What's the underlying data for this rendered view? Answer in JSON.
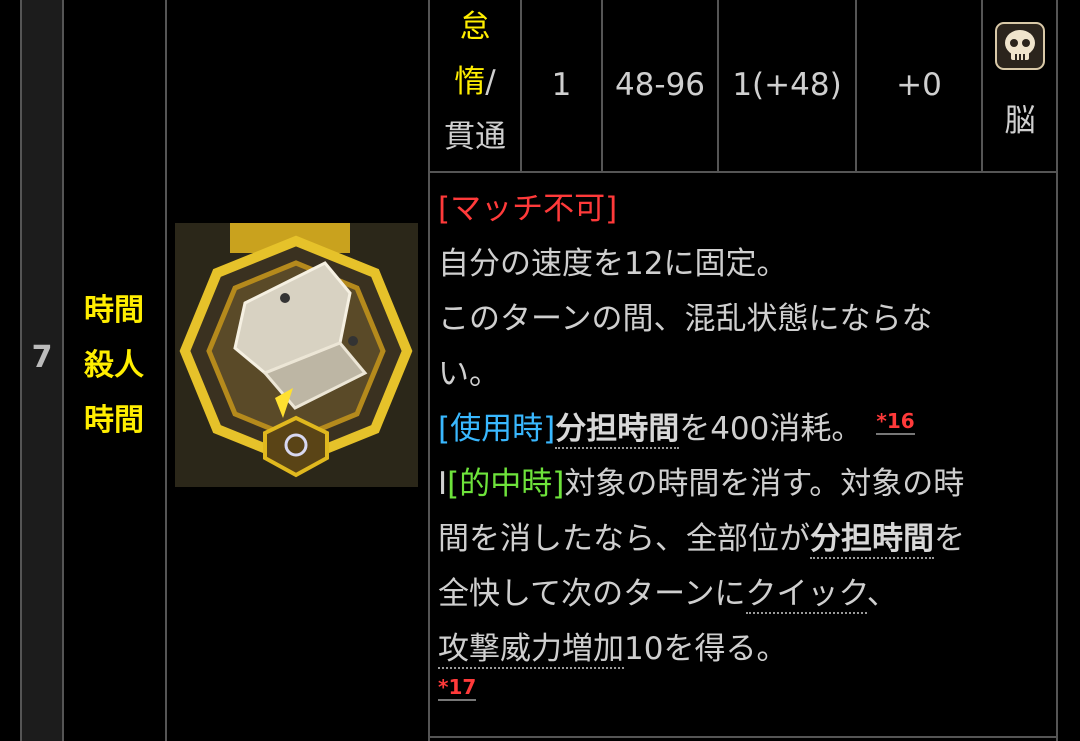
{
  "row": {
    "number": "7",
    "name_lines": [
      "時間",
      "殺人",
      "時間"
    ]
  },
  "stats": {
    "type_line1": "怠",
    "type_line2_yellow": "惰",
    "type_line2_rest": "/",
    "type_line3": "貫通",
    "col1": "1",
    "col2": "48-96",
    "col3": "1(+48)",
    "col4": "+0",
    "target_label": "脳",
    "target_icon": "skull-icon"
  },
  "description": {
    "line1": "[マッチ不可]",
    "line2": "自分の速度を12に固定。",
    "line3": "このターンの間、混乱状態にならな",
    "line4": "い。",
    "line5_tag": "[使用時]",
    "line5_kw": "分担時間",
    "line5_rest": "を400消耗。",
    "line5_fn": "*16",
    "line6_prefix": "I",
    "line6_tag": "[的中時]",
    "line6_rest": "対象の時間を消す。対象の時",
    "line7_text": "間を消したなら、全部位が",
    "line7_kw": "分担時間",
    "line7_rest": "を",
    "line8_text": "全快して次のターンに",
    "line8_kw": "クイック",
    "line8_rest": "、",
    "line9_kw": "攻撃威力増加",
    "line9_rest": "10を得る。",
    "footnote": "*17"
  },
  "colors": {
    "name": "#ffee00",
    "match_tag": "#ff3a3a",
    "use_tag": "#39b8ff",
    "hit_tag": "#6ee33b",
    "footnote": "#ff3a3a",
    "border": "#555555"
  }
}
